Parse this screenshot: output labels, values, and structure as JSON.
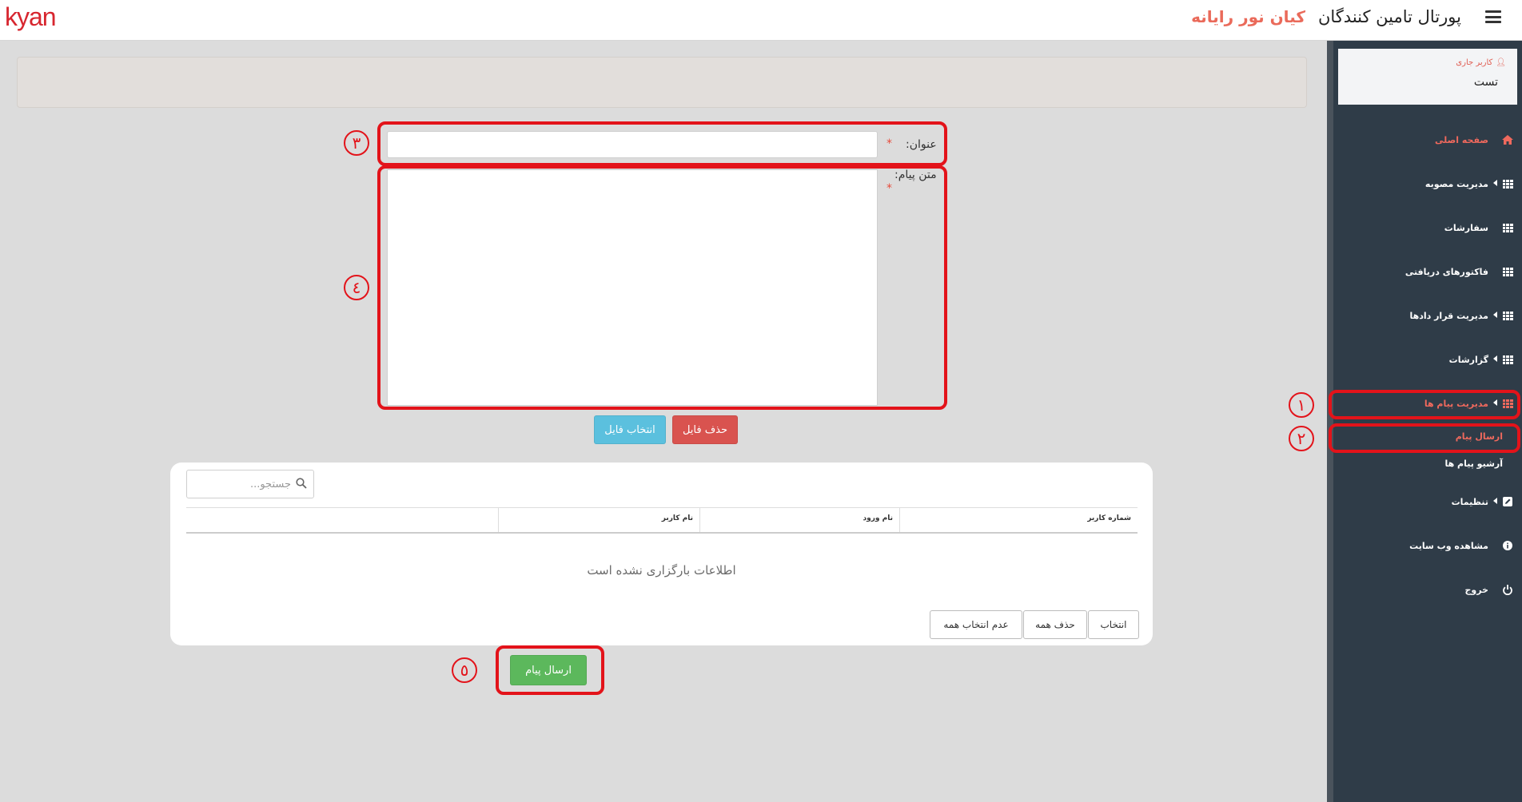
{
  "header": {
    "logo": "kyan",
    "title": "پورتال تامین کنندگان",
    "brand": "کیان نور رایانه"
  },
  "sidebar": {
    "user_label": "کاربر جاری",
    "user_name": "تست",
    "items": [
      {
        "label": "صفحه اصلی",
        "icon": "home-icon"
      },
      {
        "label": "مدیریت مصوبه",
        "icon": "grid-icon"
      },
      {
        "label": "سفارشات",
        "icon": "grid-icon"
      },
      {
        "label": "فاکتورهای دریافتی",
        "icon": "grid-icon"
      },
      {
        "label": "مدیریت قرار دادها",
        "icon": "grid-icon"
      },
      {
        "label": "گزارشات",
        "icon": "grid-icon"
      },
      {
        "label": "مدیریت پیام ها",
        "icon": "grid-icon"
      },
      {
        "label": "تنظیمات",
        "icon": "edit-icon"
      },
      {
        "label": "مشاهده وب سایت",
        "icon": "info-icon"
      },
      {
        "label": "خروج",
        "icon": "power-icon"
      }
    ],
    "sub_items": [
      {
        "label": "ارسال پیام"
      },
      {
        "label": "آرشیو پیام ها"
      }
    ]
  },
  "form": {
    "title_label": "عنوان:",
    "message_label": "متن پیام:",
    "required_mark": "*",
    "delete_file": "حذف فایل",
    "choose_file": "انتخاب فایل",
    "send": "ارسال پیام"
  },
  "table": {
    "search_placeholder": "جستجو...",
    "columns": [
      "شماره کاربر",
      "نام ورود",
      "نام کاربر",
      ""
    ],
    "empty": "اطلاعات بارگزاری نشده است",
    "buttons": [
      "انتخاب",
      "حذف همه",
      "عدم انتخاب همه"
    ]
  },
  "annotations": [
    "١",
    "٢",
    "٣",
    "٤",
    "٥"
  ],
  "colors": {
    "accent": "#f0695d",
    "sidebar": "#2f3c48",
    "annotation": "#e3131a",
    "send": "#5cb85c"
  }
}
